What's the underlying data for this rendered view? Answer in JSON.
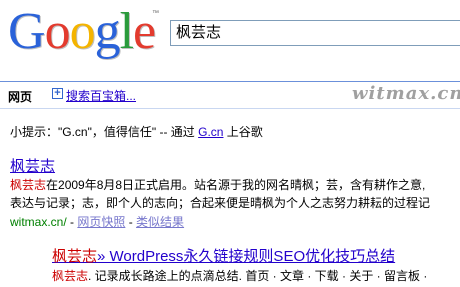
{
  "logo": {
    "letters": [
      "G",
      "o",
      "o",
      "g",
      "l",
      "e"
    ],
    "trademark": "™"
  },
  "search": {
    "query": "枫芸志"
  },
  "tabs": {
    "web": "网页",
    "more": "搜索百宝箱..."
  },
  "watermark": "witmax.cn",
  "tip": {
    "prefix": "小提示：\"G.cn\"，值得信任\" -- 通过 ",
    "link": "G.cn",
    "suffix": " 上谷歌"
  },
  "result1": {
    "title": "枫芸志",
    "snippet1_hl": "枫芸志",
    "snippet1_rest": "在2009年8月8日正式启用。站名源于我的网名晴枫；芸，含有耕作之意,",
    "snippet2": "表达与记录；志，即个人的志向；合起来便是晴枫为个人之志努力耕耘的过程记",
    "url": "witmax.cn/",
    "sep": " - ",
    "cached": "网页快照",
    "similar": "类似结果"
  },
  "result2": {
    "title_hl": "枫芸志",
    "title_rest": "» WordPress永久链接规则SEO优化技巧总结",
    "snippet_hl": "枫芸志",
    "snippet_rest": ". 记录成长路途上的点滴总结. 首页 · 文章 · 下载 · 关于 · 留言板 ·"
  },
  "colors": {
    "link": "#2200cc",
    "url_green": "#008000",
    "highlight": "#cc0000",
    "tab_border": "#6b90da"
  }
}
